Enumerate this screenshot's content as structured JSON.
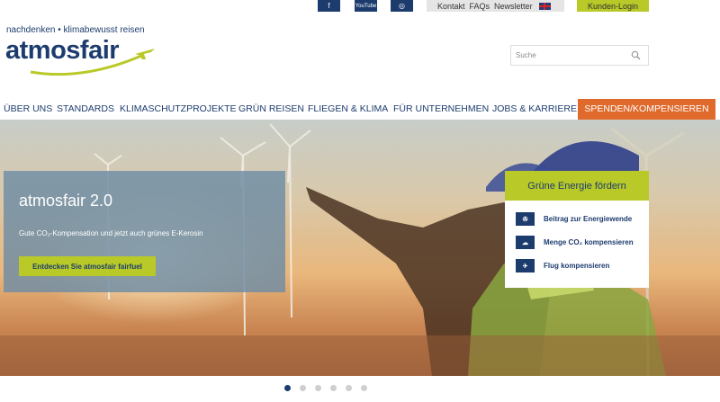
{
  "topbar": {
    "social": [
      "f",
      "YouTube",
      "◎"
    ],
    "links": [
      "Kontakt",
      "FAQs",
      "Newsletter"
    ],
    "language_flag": "english-flag-icon",
    "login_label": "Kunden-Login"
  },
  "brand": {
    "tagline": "nachdenken • klimabewusst reisen",
    "logo_text": "atmosfair",
    "colors": {
      "navy": "#1d3c6e",
      "lime": "#b8c928",
      "orange": "#e06a2c"
    }
  },
  "search": {
    "placeholder": "Suche"
  },
  "nav": {
    "items": [
      "ÜBER UNS",
      "STANDARDS",
      "KLIMASCHUTZPROJEKTE",
      "GRÜN REISEN",
      "FLIEGEN & KLIMA",
      "FÜR UNTERNEHMEN",
      "JOBS & KARRIERE"
    ],
    "cta": "SPENDEN/KOMPENSIEREN"
  },
  "hero": {
    "promo_title": "atmosfair 2.0",
    "promo_text": "Gute CO₂-Kompensation und jetzt auch grünes E-Kerosin",
    "promo_button": "Entdecken Sie atmosfair fairfuel",
    "box_title": "Grüne Energie fördern",
    "box_items": [
      {
        "label": "Beitrag zur Energiewende",
        "icon": "wind-turbine-icon"
      },
      {
        "label": "Menge CO₂ kompensieren",
        "icon": "co2-cloud-icon"
      },
      {
        "label": "Flug kompensieren",
        "icon": "airplane-icon"
      }
    ]
  },
  "carousel": {
    "slides": 6,
    "active": 1
  }
}
